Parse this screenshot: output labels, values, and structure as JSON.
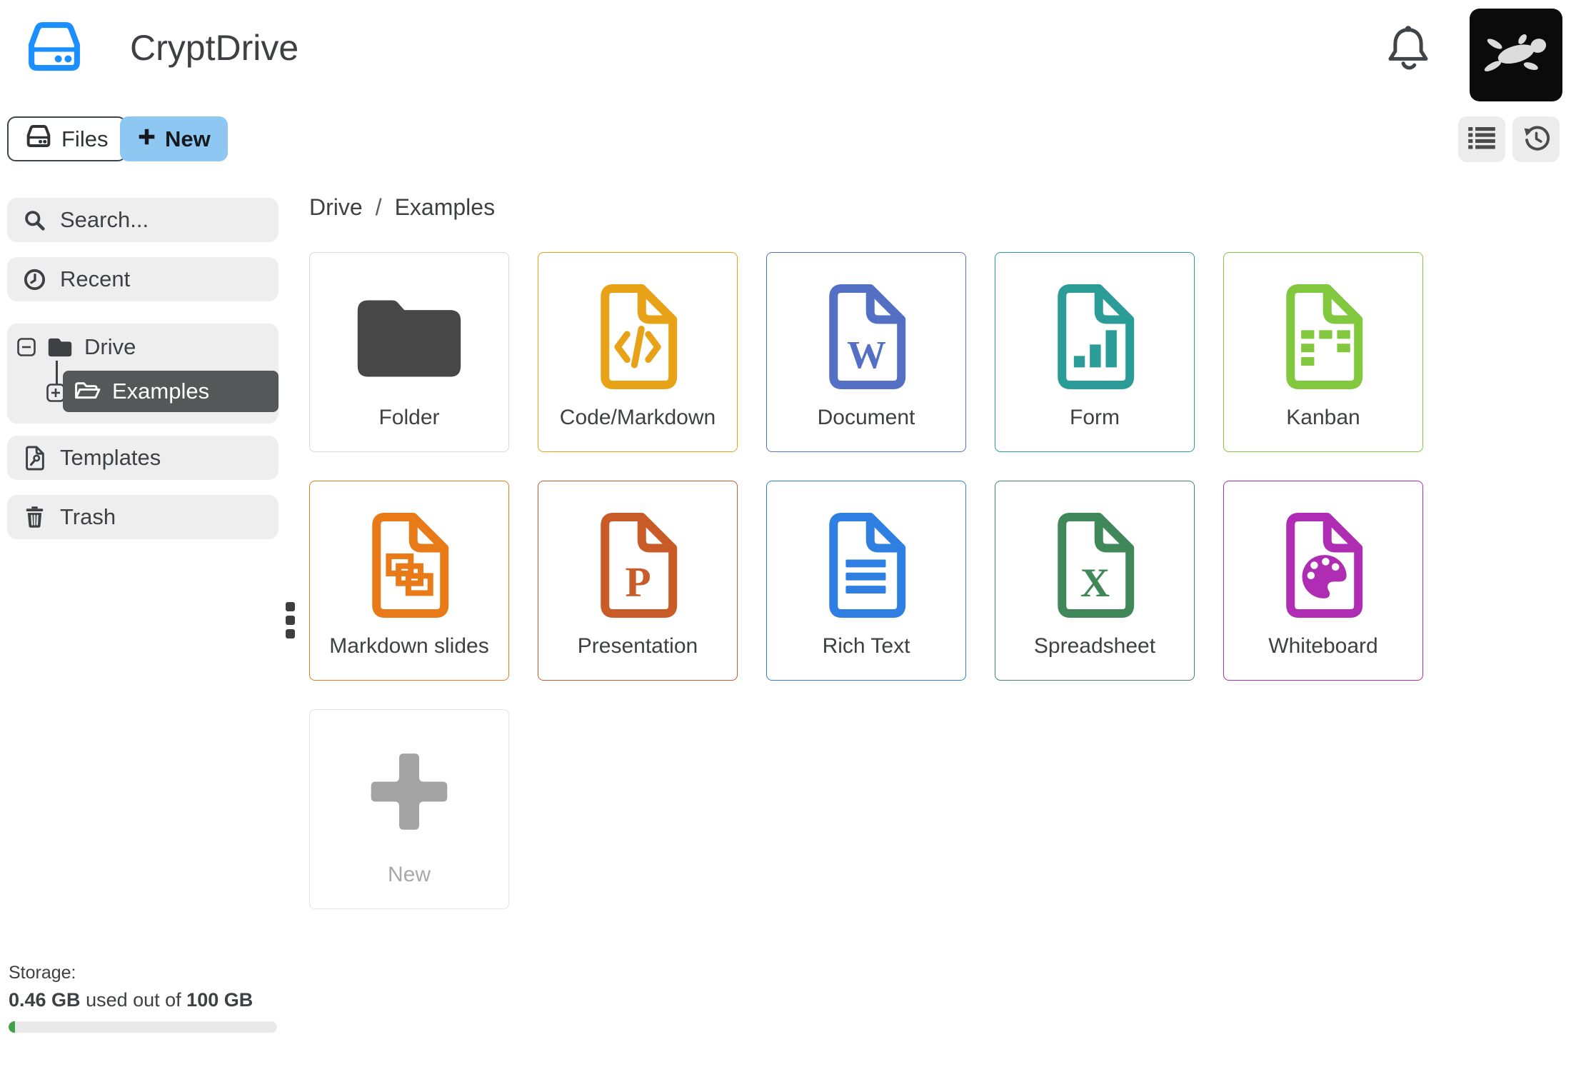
{
  "header": {
    "title": "CryptDrive"
  },
  "toolbar": {
    "files_label": "Files",
    "new_label": "New"
  },
  "sidebar": {
    "search_placeholder": "Search...",
    "recent_label": "Recent",
    "tree": {
      "root": "Drive",
      "child": "Examples"
    },
    "templates_label": "Templates",
    "trash_label": "Trash",
    "storage": {
      "heading": "Storage:",
      "used": "0.46 GB",
      "infix": " used out of ",
      "total": "100 GB",
      "percent_used": 0.46
    }
  },
  "breadcrumb": {
    "root": "Drive",
    "separator": "/",
    "current": "Examples"
  },
  "grid": {
    "cards": [
      {
        "type": "folder",
        "label": "Folder",
        "color": "#474747",
        "border": "#d9d9d9"
      },
      {
        "type": "code",
        "label": "Code/Markdown",
        "color": "#e8a217"
      },
      {
        "type": "document",
        "label": "Document",
        "color": "#5470c4"
      },
      {
        "type": "form",
        "label": "Form",
        "color": "#2c9c99"
      },
      {
        "type": "kanban",
        "label": "Kanban",
        "color": "#82c83e"
      },
      {
        "type": "slides",
        "label": "Markdown slides",
        "color": "#e87a17"
      },
      {
        "type": "presentation",
        "label": "Presentation",
        "color": "#c85b28"
      },
      {
        "type": "richtext",
        "label": "Rich Text",
        "color": "#2e7fe1"
      },
      {
        "type": "sheet",
        "label": "Spreadsheet",
        "color": "#40875a"
      },
      {
        "type": "whiteboard",
        "label": "Whiteboard",
        "color": "#ae2db2"
      },
      {
        "type": "new",
        "label": "New",
        "color": "#a3a3a3",
        "border": "#e5e5e5",
        "label_color": "#a9a9a9"
      }
    ]
  },
  "colors": {
    "accent_blue": "#1b8fff",
    "new_button_bg": "#8fc7f3",
    "sidebar_item_bg": "#eeeeee",
    "selected_tree_bg": "#565758",
    "text": "#3f4044",
    "progress_green": "#43a047"
  }
}
